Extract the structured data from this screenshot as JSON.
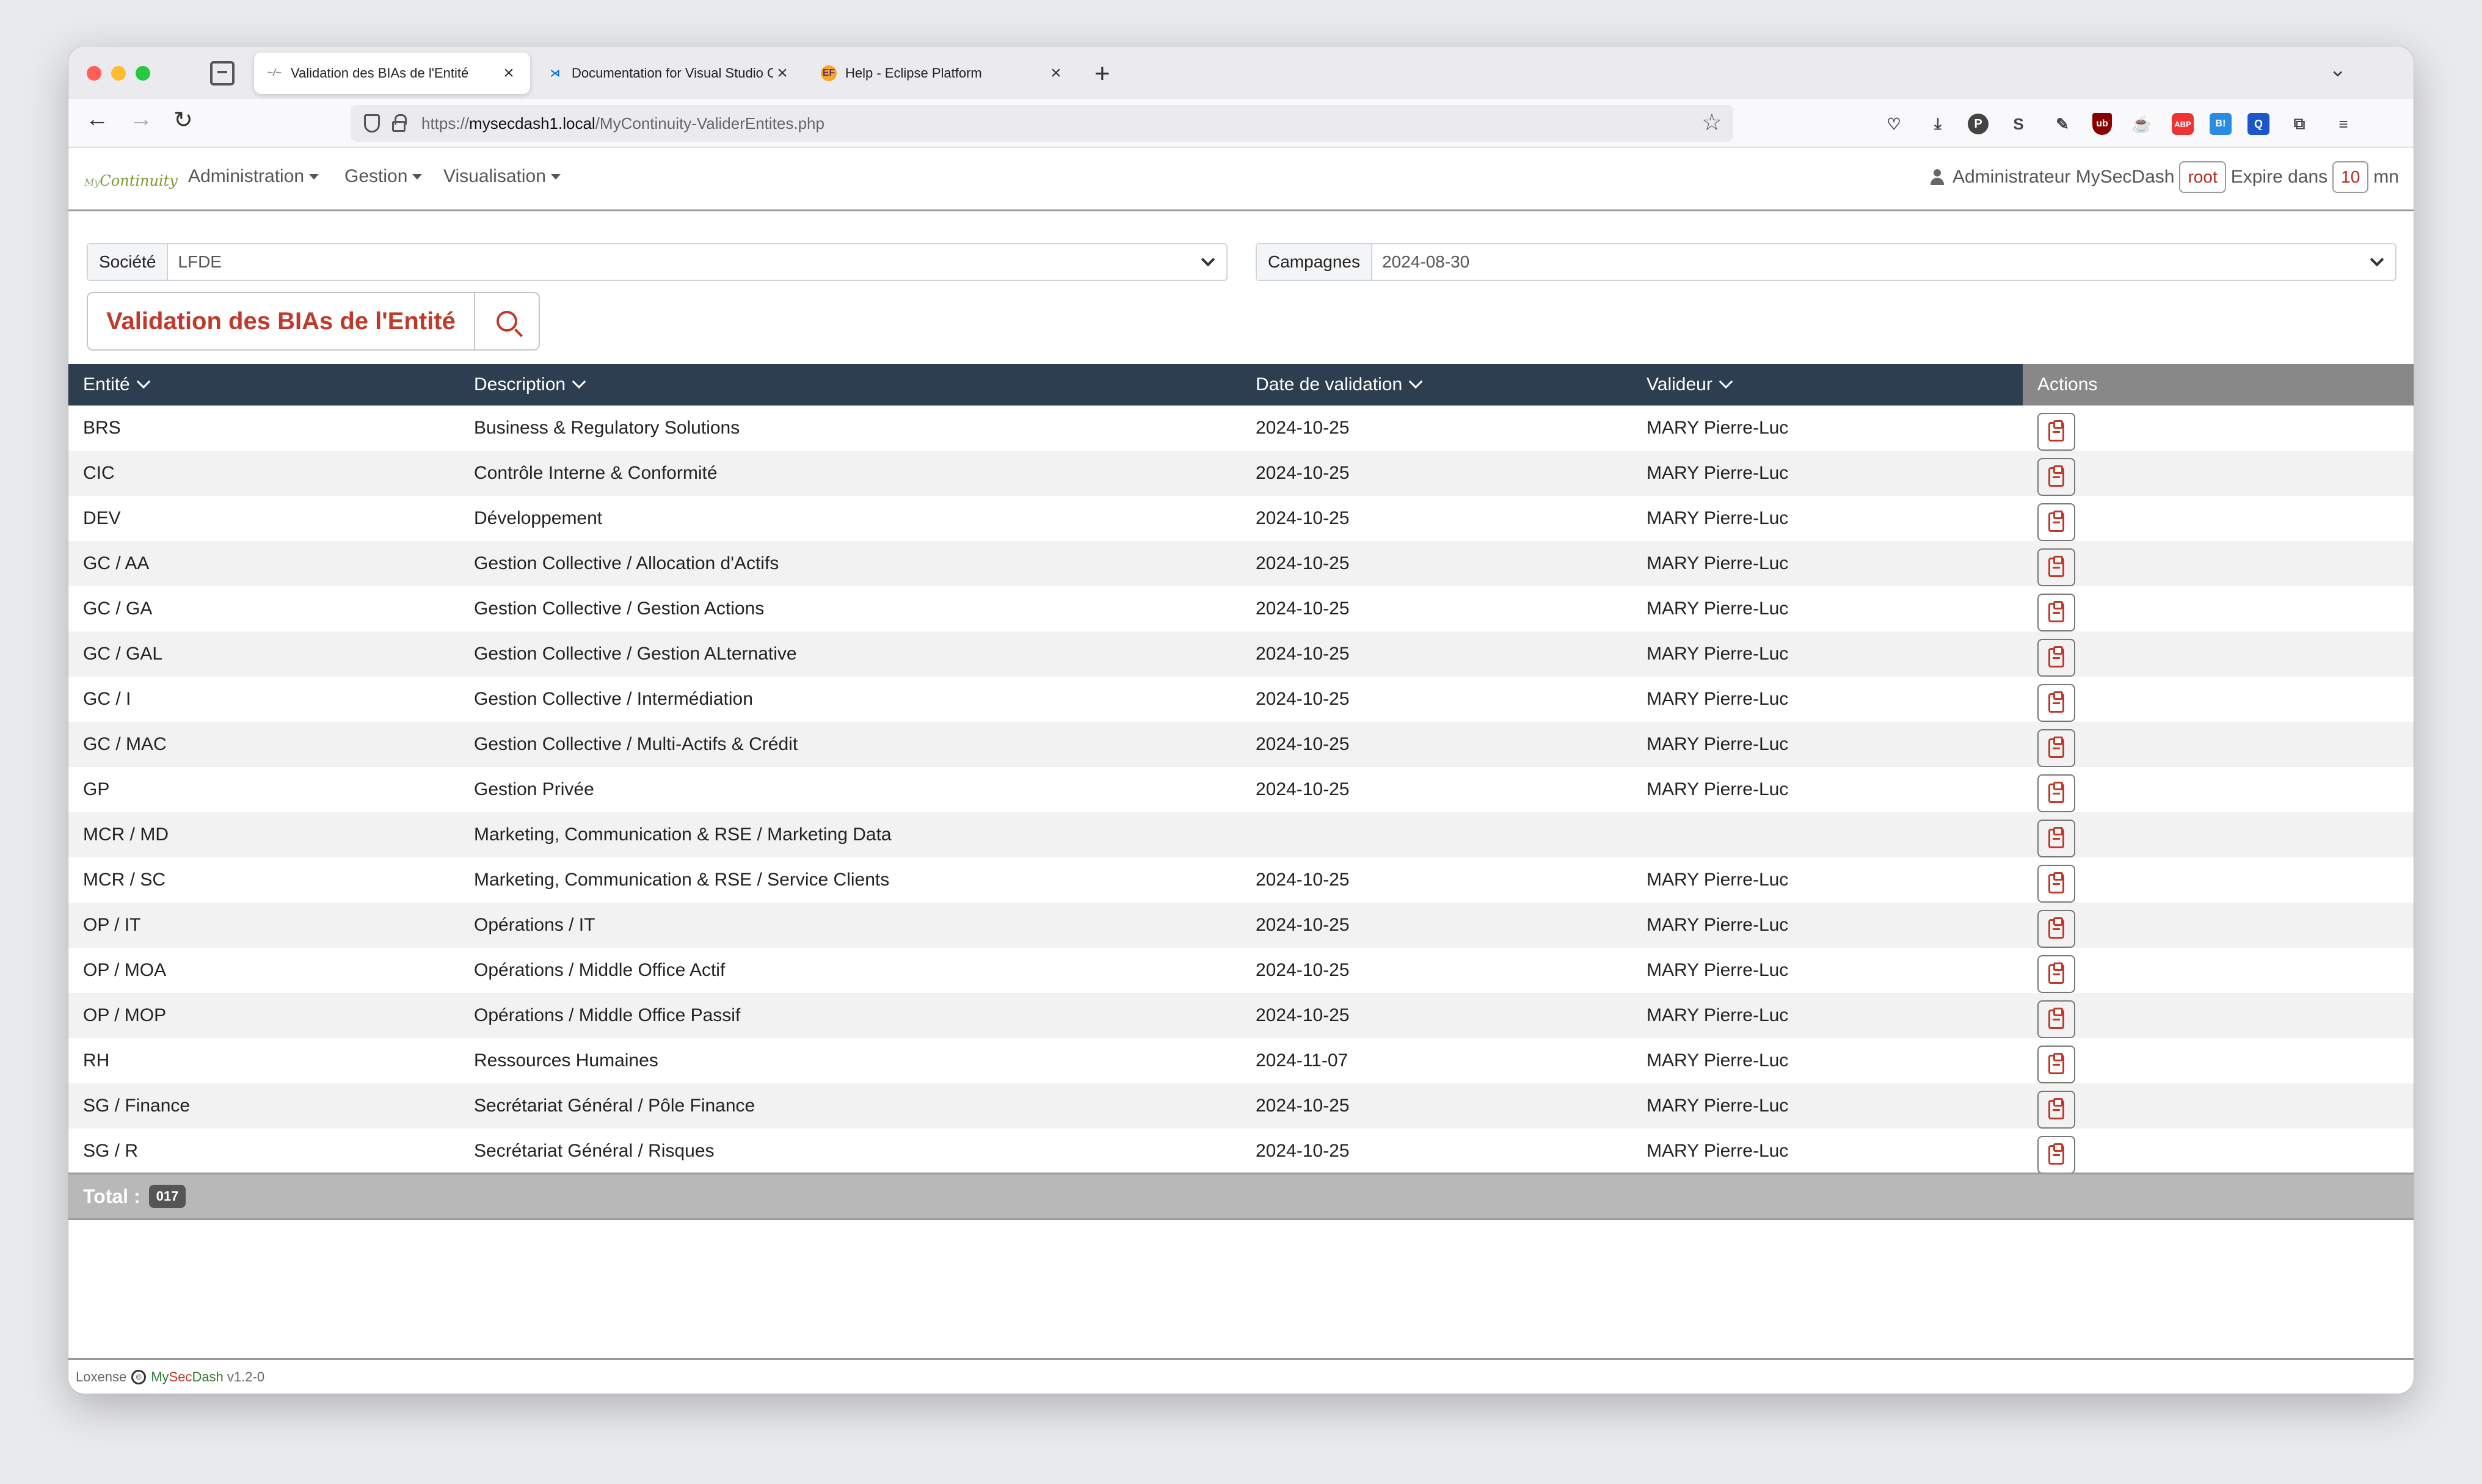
{
  "browser": {
    "tabs": [
      {
        "label": "Validation des BIAs de l'Entité",
        "favicon": "mc"
      },
      {
        "label": "Documentation for Visual Studio Code",
        "favicon": "vscode"
      },
      {
        "label": "Help - Eclipse Platform",
        "favicon": "eclipse"
      }
    ],
    "url_prefix": "https://",
    "url_host": "mysecdash1.local",
    "url_path": "/MyContinuity-ValiderEntites.php"
  },
  "header": {
    "logo_prefix": "My",
    "logo_main": "Continuity",
    "menus": [
      "Administration",
      "Gestion",
      "Visualisation"
    ],
    "user_label": "Administrateur MySecDash",
    "user_login": "root",
    "expire_label": "Expire dans",
    "expire_value": "10",
    "expire_unit": "mn"
  },
  "filters": {
    "societe_label": "Société",
    "societe_value": "LFDE",
    "campagnes_label": "Campagnes",
    "campagnes_value": "2024-08-30"
  },
  "page_title": "Validation des BIAs de l'Entité",
  "table": {
    "columns": [
      "Entité",
      "Description",
      "Date de validation",
      "Valideur",
      "Actions"
    ],
    "rows": [
      {
        "entite": "BRS",
        "description": "Business & Regulatory Solutions",
        "date": "2024-10-25",
        "valideur": "MARY Pierre-Luc"
      },
      {
        "entite": "CIC",
        "description": "Contrôle Interne & Conformité",
        "date": "2024-10-25",
        "valideur": "MARY Pierre-Luc"
      },
      {
        "entite": "DEV",
        "description": "Développement",
        "date": "2024-10-25",
        "valideur": "MARY Pierre-Luc"
      },
      {
        "entite": "GC / AA",
        "description": "Gestion Collective / Allocation d'Actifs",
        "date": "2024-10-25",
        "valideur": "MARY Pierre-Luc"
      },
      {
        "entite": "GC / GA",
        "description": "Gestion Collective / Gestion Actions",
        "date": "2024-10-25",
        "valideur": "MARY Pierre-Luc"
      },
      {
        "entite": "GC / GAL",
        "description": "Gestion Collective / Gestion ALternative",
        "date": "2024-10-25",
        "valideur": "MARY Pierre-Luc"
      },
      {
        "entite": "GC / I",
        "description": "Gestion Collective / Intermédiation",
        "date": "2024-10-25",
        "valideur": "MARY Pierre-Luc"
      },
      {
        "entite": "GC / MAC",
        "description": "Gestion Collective / Multi-Actifs & Crédit",
        "date": "2024-10-25",
        "valideur": "MARY Pierre-Luc"
      },
      {
        "entite": "GP",
        "description": "Gestion Privée",
        "date": "2024-10-25",
        "valideur": "MARY Pierre-Luc"
      },
      {
        "entite": "MCR / MD",
        "description": "Marketing, Communication & RSE / Marketing Data",
        "date": "",
        "valideur": ""
      },
      {
        "entite": "MCR / SC",
        "description": "Marketing, Communication & RSE / Service Clients",
        "date": "2024-10-25",
        "valideur": "MARY Pierre-Luc"
      },
      {
        "entite": "OP / IT",
        "description": "Opérations / IT",
        "date": "2024-10-25",
        "valideur": "MARY Pierre-Luc"
      },
      {
        "entite": "OP / MOA",
        "description": "Opérations / Middle Office Actif",
        "date": "2024-10-25",
        "valideur": "MARY Pierre-Luc"
      },
      {
        "entite": "OP / MOP",
        "description": "Opérations / Middle Office Passif",
        "date": "2024-10-25",
        "valideur": "MARY Pierre-Luc"
      },
      {
        "entite": "RH",
        "description": "Ressources Humaines",
        "date": "2024-11-07",
        "valideur": "MARY Pierre-Luc"
      },
      {
        "entite": "SG / Finance",
        "description": "Secrétariat Général / Pôle Finance",
        "date": "2024-10-25",
        "valideur": "MARY Pierre-Luc"
      },
      {
        "entite": "SG / R",
        "description": "Secrétariat Général / Risques",
        "date": "2024-10-25",
        "valideur": "MARY Pierre-Luc"
      }
    ],
    "total_label": "Total :",
    "total_value": "017"
  },
  "footer": {
    "company": "Loxense",
    "brand_my": "My",
    "brand_sec": "Sec",
    "brand_dash": "Dash",
    "version": "v1.2-0"
  },
  "colors": {
    "accent_red": "#c0392b",
    "table_header": "#2c3e50"
  }
}
